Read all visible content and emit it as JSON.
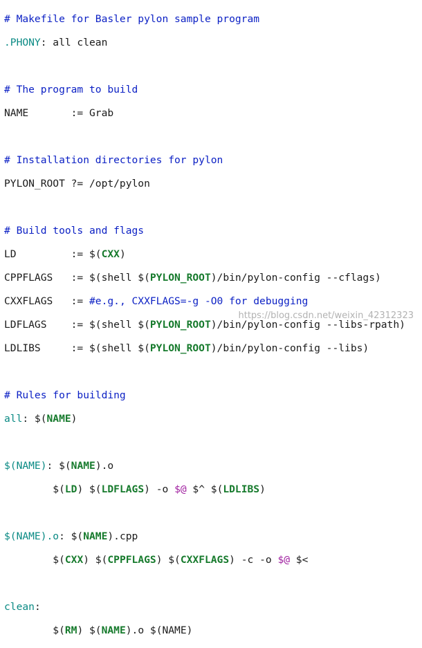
{
  "editor": {
    "comment_header": "# Makefile for Basler pylon sample program",
    "phony_target": ".PHONY",
    "phony_deps": ": all clean",
    "comment_program": "# The program to build",
    "name_assign": "NAME       := Grab",
    "comment_install": "# Installation directories for pylon",
    "pylon_root_assign": "PYLON_ROOT ?= /opt/pylon",
    "comment_tools": "# Build tools and flags",
    "ld": {
      "lhs": "LD         := $(",
      "var": "CXX",
      "rhs": ")"
    },
    "cppflags": {
      "lhs": "CPPFLAGS   := $(shell $(",
      "var": "PYLON_ROOT",
      "rhs": ")/bin/pylon-config --cflags)"
    },
    "cxxflags": {
      "lhs": "CXXFLAGS   := ",
      "comment": "#e.g., CXXFLAGS=-g -O0 for debugging"
    },
    "ldflags": {
      "lhs": "LDFLAGS    := $(shell $(",
      "var": "PYLON_ROOT",
      "rhs": ")/bin/pylon-config --libs-rpath)"
    },
    "ldlibs": {
      "lhs": "LDLIBS     := $(shell $(",
      "var": "PYLON_ROOT",
      "rhs": ")/bin/pylon-config --libs)"
    },
    "comment_rules": "# Rules for building",
    "all_rule": {
      "target": "all",
      "sep": ": $(",
      "var": "NAME",
      "end": ")"
    },
    "name_rule": {
      "target": "$(NAME)",
      "sep": ": $(",
      "var": "NAME",
      "end": ").o",
      "recipe": [
        "        $(",
        "LD",
        ") $(",
        "LDFLAGS",
        ") -o ",
        "$@",
        " $^ $(",
        "LDLIBS",
        ")"
      ]
    },
    "obj_rule": {
      "target": "$(NAME).o",
      "sep": ": $(",
      "var": "NAME",
      "end": ").cpp",
      "recipe": [
        "        $(",
        "CXX",
        ") $(",
        "CPPFLAGS",
        ") $(",
        "CXXFLAGS",
        ") -c -o ",
        "$@",
        " $<"
      ]
    },
    "clean_rule": {
      "target": "clean",
      "sep": ":",
      "recipe": [
        "        $(",
        "RM",
        ") $(",
        "NAME",
        ").o $(NAME)"
      ]
    }
  },
  "watermark": "https://blog.csdn.net/weixin_42312323"
}
